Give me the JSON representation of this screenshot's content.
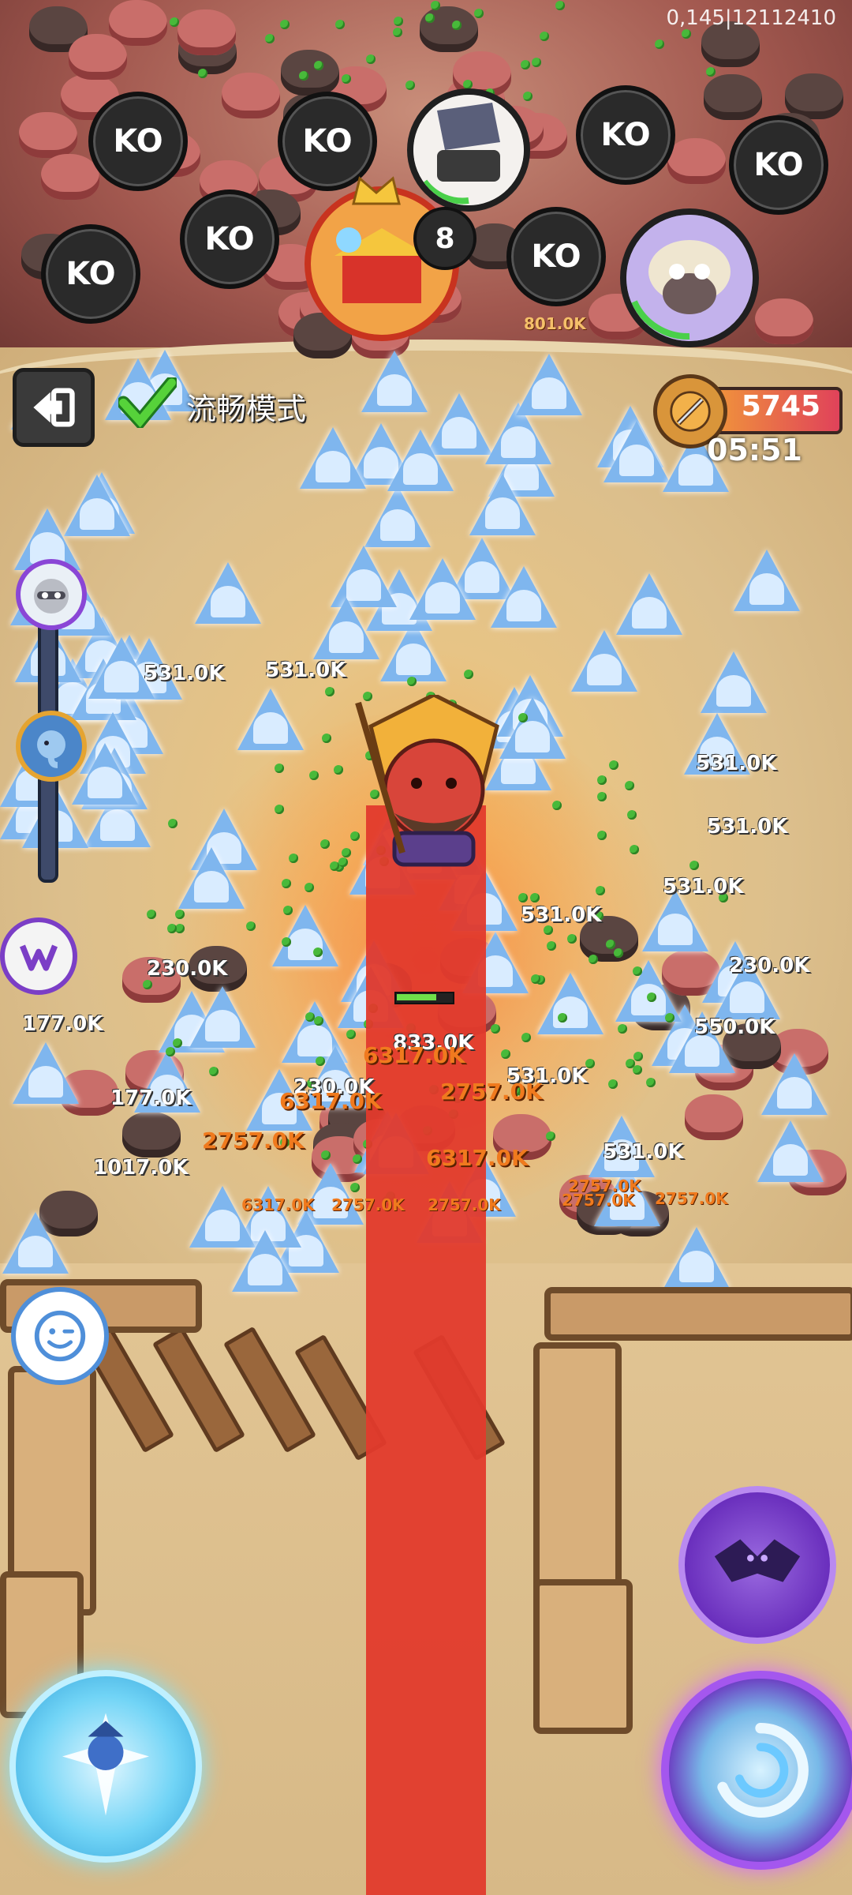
{
  "status": {
    "debug_text": "0,145|12112410"
  },
  "ko_board": {
    "ko_label": "KO",
    "leader_level": "8",
    "slots": [
      "KO",
      "KO",
      "KO",
      "KO",
      "KO",
      "KO",
      "KO"
    ]
  },
  "hud": {
    "mode_label": "流畅模式",
    "score": "5745",
    "timer": "05:51"
  },
  "damage_numbers": {
    "n1": "531.0K",
    "n2": "531.0K",
    "n3": "531.0K",
    "n4": "531.0K",
    "n5": "531.0K",
    "n6": "531.0K",
    "n7": "531.0K",
    "n8": "531.0K",
    "n9": "230.0K",
    "n10": "230.0K",
    "n11": "177.0K",
    "n12": "177.0K",
    "n13": "833.0K",
    "n14": "6317.0K",
    "n15": "2757.0K",
    "n16": "230.0K",
    "n17": "6317.0K",
    "n18": "2757.0K",
    "n19": "6317.0K",
    "n20": "2757.0K",
    "n21": "6317.0K",
    "n22": "2757.0K",
    "n23": "2757.0K",
    "n24": "801.0K",
    "n25": "1017.0K",
    "n26": "550.0K",
    "n27": "2757.0K",
    "n28": "2757.0K"
  },
  "colors": {
    "laser": "#e23a2c",
    "score_gradient_start": "#f19a39",
    "score_gradient_end": "#e0425a",
    "ko_bg": "#2a2a2a",
    "skill_purple": "#a457ee",
    "skill_ice": "#71d4f6"
  },
  "icons": {
    "back": "back-arrow-icon",
    "check": "checkmark-icon",
    "score": "sword-badge-icon",
    "emoji": "wink-face-icon"
  }
}
